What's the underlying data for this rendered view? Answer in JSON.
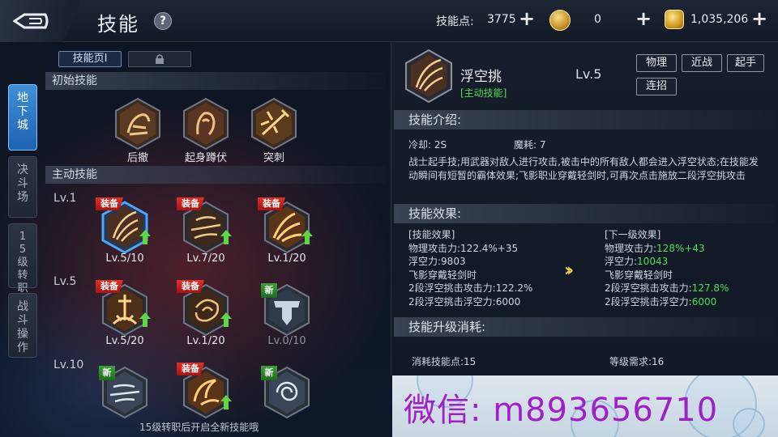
{
  "header": {
    "title": "技能",
    "help": "?",
    "skill_points_label": "技能点:",
    "skill_points_value": "3775",
    "coin_value": "0",
    "gold_value": "1,035,206"
  },
  "side_tabs": [
    {
      "label": "地下城",
      "active": true
    },
    {
      "label": "决斗场",
      "active": false
    },
    {
      "label": "15级转职",
      "active": false
    },
    {
      "label": "战斗操作",
      "active": false
    }
  ],
  "page_tabs": {
    "page1": "技能页Ⅰ"
  },
  "left": {
    "section_initial": "初始技能",
    "section_active": "主动技能",
    "levels": [
      "Lv.1",
      "Lv.5",
      "Lv.10"
    ],
    "equip_badge": "装备",
    "new_badge": "新",
    "initial_skills": [
      {
        "label": "后撤"
      },
      {
        "label": "起身蹲伏"
      },
      {
        "label": "突刺"
      }
    ],
    "active_skills": [
      {
        "label": "Lv.5/10",
        "badge": "equip",
        "arrow": true,
        "selected": true
      },
      {
        "label": "Lv.7/20",
        "badge": "equip",
        "arrow": true
      },
      {
        "label": "Lv.1/20",
        "badge": "equip",
        "arrow": true
      },
      {
        "label": "Lv.5/20",
        "badge": "equip",
        "arrow": true
      },
      {
        "label": "Lv.1/20",
        "badge": "equip",
        "arrow": true
      },
      {
        "label": "Lv.0/10",
        "badge": "new",
        "arrow": false,
        "locked": true
      },
      {
        "label": "",
        "badge": "new",
        "arrow": false
      },
      {
        "label": "",
        "badge": "equip",
        "arrow": true
      },
      {
        "label": "",
        "badge": "new",
        "arrow": false
      }
    ],
    "note": "15级转职后开启全新技能哦"
  },
  "detail": {
    "name": "浮空挑",
    "type": "[主动技能]",
    "level": "Lv.5",
    "tags": [
      "物理",
      "近战",
      "起手",
      "连招"
    ],
    "intro_title": "技能介绍:",
    "cooldown": "冷却: 2S",
    "mana": "魔耗: 7",
    "description": "战士起手技;用武器对敌人进行攻击,被击中的所有敌人都会进入浮空状态;在技能发动瞬间有短暂的霸体效果;飞影职业穿戴轻剑时,可再次点击施放二段浮空挑攻击",
    "effect_title": "技能效果:",
    "current": {
      "heading": "[技能效果]",
      "lines": [
        {
          "k": "物理攻击力:",
          "v": "122.4%+35"
        },
        {
          "k": "浮空力:",
          "v": "9803"
        },
        {
          "k": "飞影穿戴轻剑时",
          "v": ""
        },
        {
          "k": "2段浮空挑击攻击力:",
          "v": "122.2%"
        },
        {
          "k": "2段浮空挑击浮空力:",
          "v": "6000"
        }
      ]
    },
    "next": {
      "heading": "[下一级效果]",
      "lines": [
        {
          "k": "物理攻击力:",
          "v": "128%+43"
        },
        {
          "k": "浮空力:",
          "v": "10043"
        },
        {
          "k": "飞影穿戴轻剑时",
          "v": ""
        },
        {
          "k": "2段浮空挑击攻击力:",
          "v": "127.8%"
        },
        {
          "k": "2段浮空挑击浮空力:",
          "v": "6000"
        }
      ]
    },
    "arrow": "»",
    "cost_title": "技能升级消耗:",
    "cost_points": "消耗技能点:15",
    "cost_level": "等级需求:16"
  },
  "watermark": "微信: m893656710"
}
